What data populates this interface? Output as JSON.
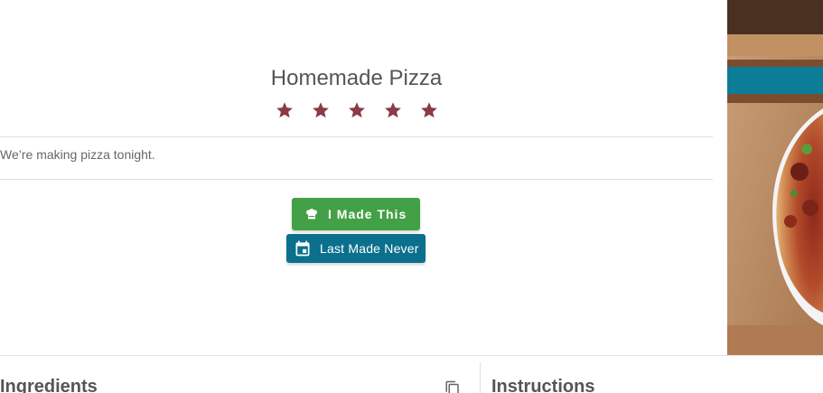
{
  "recipe": {
    "title": "Homemade Pizza",
    "rating": {
      "value": 5,
      "max": 5
    },
    "description": "We’re making pizza tonight."
  },
  "actions": {
    "made_this_label": "I Made This",
    "last_made_label": "Last Made Never"
  },
  "sections": {
    "ingredients_title": "Ingredients",
    "instructions_title": "Instructions"
  },
  "colors": {
    "star": "#8b3a46",
    "made_button": "#43a047",
    "last_made_button": "#0b708d"
  },
  "icons": {
    "star": "star-icon",
    "chef_hat": "chef-hat-icon",
    "calendar": "calendar-icon",
    "copy": "copy-icon"
  }
}
